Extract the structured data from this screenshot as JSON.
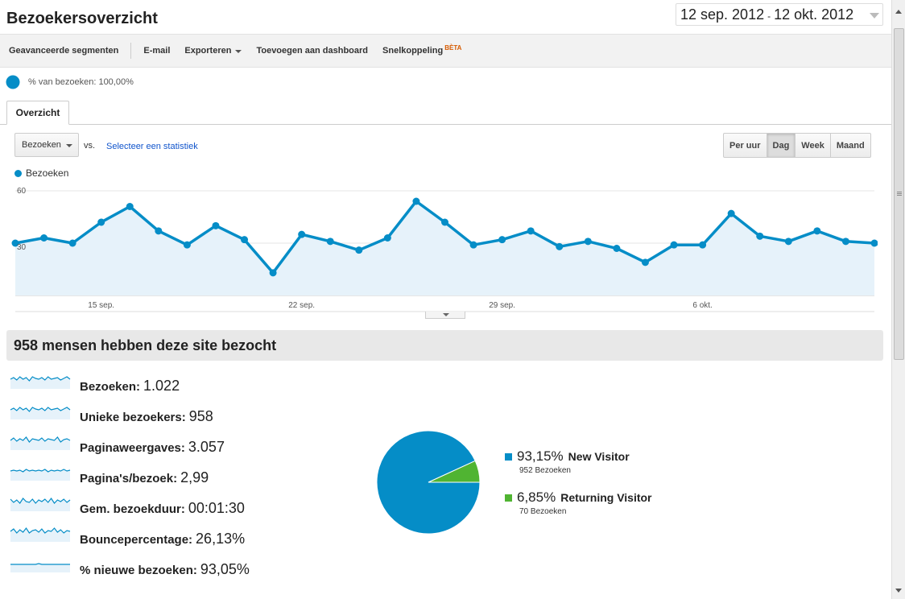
{
  "header": {
    "title": "Bezoekersoverzicht",
    "date_start": "12 sep. 2012",
    "date_sep": "-",
    "date_end": "12 okt. 2012"
  },
  "toolbar": {
    "advanced_segments": "Geavanceerde segmenten",
    "email": "E-mail",
    "export": "Exporteren",
    "add_to_dashboard": "Toevoegen aan dashboard",
    "shortcut": "Snelkoppeling",
    "beta": "BÈTA"
  },
  "segment": {
    "label": "% van bezoeken: 100,00%"
  },
  "tabs": {
    "overview": "Overzicht"
  },
  "chart_controls": {
    "metric": "Bezoeken",
    "vs": "vs.",
    "select_stat": "Selecteer een statistiek",
    "granularity": [
      "Per uur",
      "Dag",
      "Week",
      "Maand"
    ],
    "active_granularity": "Dag"
  },
  "chart_data": {
    "type": "area",
    "legend": "Bezoeken",
    "y_ticks": [
      "60",
      "30"
    ],
    "ylim": [
      0,
      60
    ],
    "x_tick_labels": [
      "15 sep.",
      "22 sep.",
      "29 sep.",
      "6 okt."
    ],
    "x_tick_index": [
      3,
      10,
      17,
      24
    ],
    "values": [
      30,
      33,
      30,
      42,
      51,
      37,
      29,
      40,
      32,
      13,
      35,
      31,
      26,
      33,
      54,
      42,
      29,
      32,
      37,
      28,
      31,
      27,
      19,
      29,
      29,
      47,
      34,
      31,
      37,
      31,
      30
    ],
    "line_color": "#058dc7",
    "fill_color": "#e6f2fa"
  },
  "summary": {
    "headline": "958 mensen hebben deze site bezocht",
    "metrics": [
      {
        "label": "Bezoeken:",
        "value": "1.022"
      },
      {
        "label": "Unieke bezoekers:",
        "value": "958"
      },
      {
        "label": "Paginaweergaves:",
        "value": "3.057"
      },
      {
        "label": "Pagina's/bezoek:",
        "value": "2,99"
      },
      {
        "label": "Gem. bezoekduur:",
        "value": "00:01:30"
      },
      {
        "label": "Bouncepercentage:",
        "value": "26,13%"
      },
      {
        "label": "% nieuwe bezoeken:",
        "value": "93,05%"
      }
    ]
  },
  "visitor_pie": {
    "slices": [
      {
        "pct": "93,15%",
        "fraction": 0.9315,
        "name": "New Visitor",
        "visits": "952 Bezoeken",
        "color": "#058dc7"
      },
      {
        "pct": "6,85%",
        "fraction": 0.0685,
        "name": "Returning Visitor",
        "visits": "70 Bezoeken",
        "color": "#50b432"
      }
    ]
  }
}
